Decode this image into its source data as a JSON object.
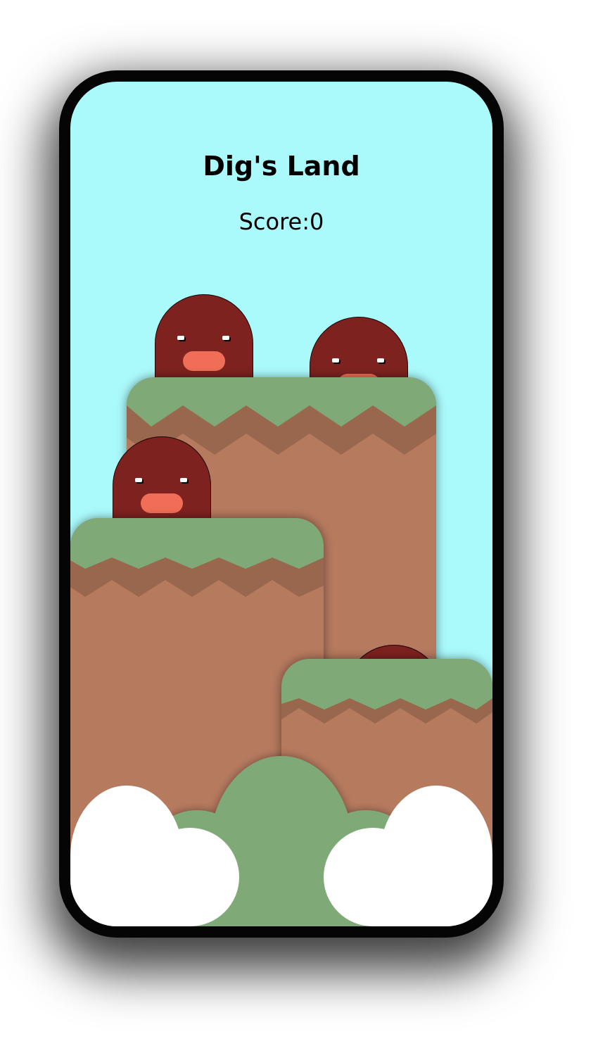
{
  "game": {
    "title": "Dig's Land",
    "score_label": "Score:",
    "score_value": "0"
  },
  "colors": {
    "sky": "#abfafb",
    "mole_body": "#7e221f",
    "mole_nose": "#f06e57",
    "grass": "#7fa977",
    "dirt_stripe": "#99674d",
    "dirt": "#b67a5f",
    "cloud": "#ffffff",
    "phone_frame": "#050505"
  },
  "moles": [
    {
      "name": "mole-1"
    },
    {
      "name": "mole-2"
    },
    {
      "name": "mole-3"
    },
    {
      "name": "mole-4"
    }
  ]
}
